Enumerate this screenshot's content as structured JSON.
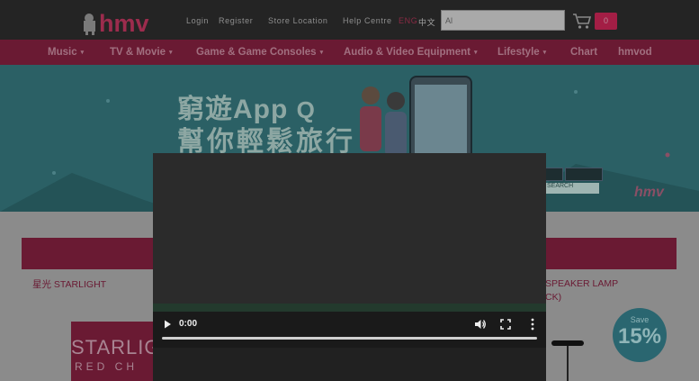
{
  "header": {
    "links": [
      {
        "label": "Login"
      },
      {
        "label": "Register"
      },
      {
        "label": "Store Location"
      },
      {
        "label": "Help Centre"
      },
      {
        "label": "ENG"
      },
      {
        "label": "中文"
      }
    ],
    "search": {
      "value": "Al"
    },
    "cart": {
      "count": "0"
    }
  },
  "nav": {
    "items": [
      {
        "label": "Music"
      },
      {
        "label": "TV & Movie"
      },
      {
        "label": "Game & Game Consoles"
      },
      {
        "label": "Audio & Video Equipment"
      },
      {
        "label": "Lifestyle"
      },
      {
        "label": "Chart"
      },
      {
        "label": "hmvod"
      }
    ]
  },
  "banner": {
    "line1": "窮遊App",
    "line2": "幫你輕鬆旅行",
    "mini_search_label": "SEARCH"
  },
  "products": {
    "left_title": "星光 STARLIGHT",
    "right_title_line1": "SPEAKER LAMP",
    "right_title_line2": "CK)",
    "album_text1": "STARLIG",
    "album_text2": "RED CH",
    "badge_top": "Save",
    "badge_value": "15%"
  },
  "video": {
    "time": "0:00"
  },
  "colors": {
    "brand": "#a31e45",
    "overlay_tint": "#8b8b8b"
  }
}
